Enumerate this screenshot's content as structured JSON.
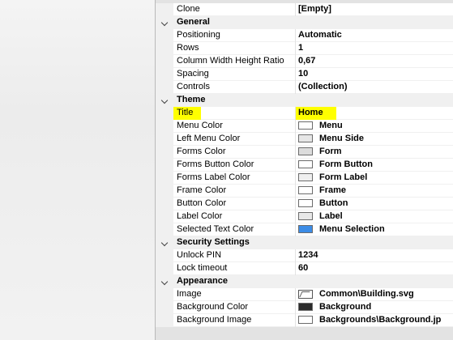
{
  "grid": {
    "top_row": {
      "name": "Clone",
      "value": "[Empty]"
    },
    "categories": [
      {
        "label": "General",
        "rows": [
          {
            "name": "Positioning",
            "value": "Automatic"
          },
          {
            "name": "Rows",
            "value": "1"
          },
          {
            "name": "Column Width Height Ratio",
            "value": "0,67"
          },
          {
            "name": "Spacing",
            "value": "10"
          },
          {
            "name": "Controls",
            "value": "(Collection)"
          }
        ]
      },
      {
        "label": "Theme",
        "rows": [
          {
            "name": "Title",
            "value": "Home",
            "highlight": true
          },
          {
            "name": "Menu Color",
            "value": "Menu",
            "swatch": "#ffffff"
          },
          {
            "name": "Left Menu Color",
            "value": "Menu Side",
            "swatch": "#e6e6e6"
          },
          {
            "name": "Forms Color",
            "value": "Form",
            "swatch": "#dcdcdc"
          },
          {
            "name": "Forms Button Color",
            "value": "Form Button",
            "swatch": "#ffffff"
          },
          {
            "name": "Forms Label Color",
            "value": "Form Label",
            "swatch": "#efefef"
          },
          {
            "name": "Frame Color",
            "value": "Frame",
            "swatch": "#ffffff"
          },
          {
            "name": "Button Color",
            "value": "Button",
            "swatch": "#ffffff"
          },
          {
            "name": "Label Color",
            "value": "Label",
            "swatch": "#e8e8e8"
          },
          {
            "name": "Selected Text Color",
            "value": "Menu Selection",
            "swatch": "#3c8ce6"
          }
        ]
      },
      {
        "label": "Security Settings",
        "rows": [
          {
            "name": "Unlock PIN",
            "value": "1234"
          },
          {
            "name": "Lock timeout",
            "value": "60"
          }
        ]
      },
      {
        "label": "Appearance",
        "rows": [
          {
            "name": "Image",
            "value": "Common\\Building.svg",
            "icon": "image-file-icon"
          },
          {
            "name": "Background Color",
            "value": "Background",
            "swatch": "#2b2b2b"
          },
          {
            "name": "Background Image",
            "value": "Backgrounds\\Background.jp",
            "swatch": "#ffffff"
          }
        ]
      }
    ]
  },
  "colors": {
    "highlight": "#ffff00",
    "selected_text": "#3c8ce6"
  }
}
